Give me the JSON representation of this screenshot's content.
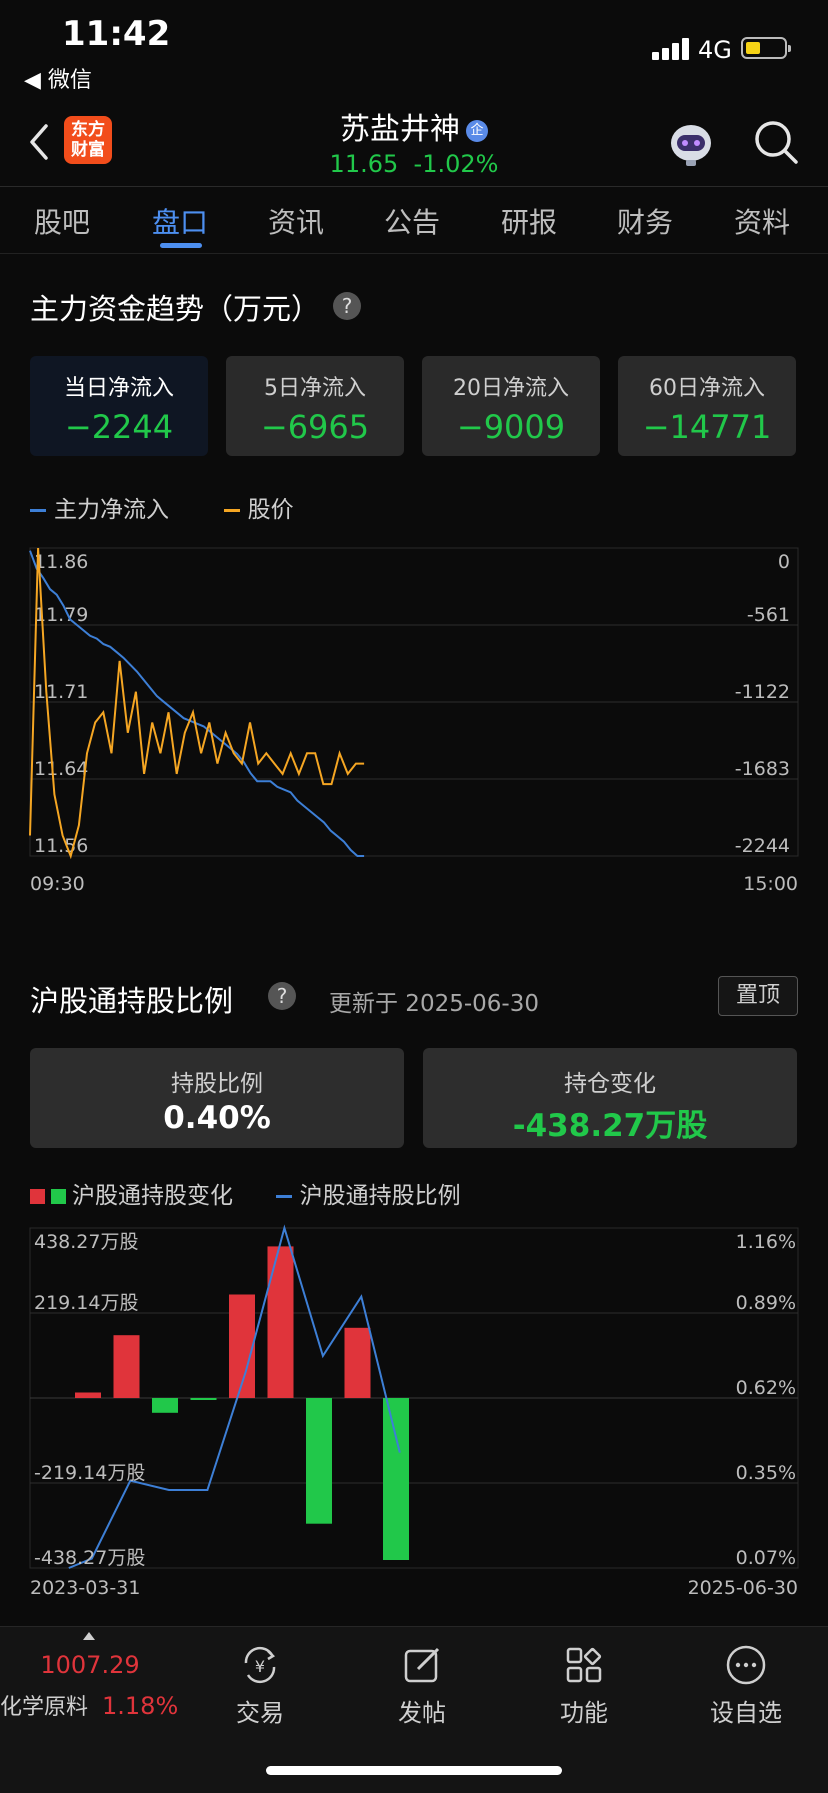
{
  "status": {
    "time": "11:42",
    "back_app": "◀ 微信",
    "network": "4G"
  },
  "header": {
    "logo_line1": "东方",
    "logo_line2": "财富",
    "stock_name": "苏盐井神",
    "badge": "企",
    "price": "11.65",
    "change": "-1.02%"
  },
  "tabs": [
    "股吧",
    "盘口",
    "资讯",
    "公告",
    "研报",
    "财务",
    "资料"
  ],
  "active_tab": "盘口",
  "flow": {
    "title": "主力资金趋势（万元）",
    "cards": [
      {
        "label": "当日净流入",
        "value": "−2244"
      },
      {
        "label": "5日净流入",
        "value": "−6965"
      },
      {
        "label": "20日净流入",
        "value": "−9009"
      },
      {
        "label": "60日净流入",
        "value": "−14771"
      }
    ],
    "legend_flow": "主力净流入",
    "legend_price": "股价",
    "left_ticks": [
      "11.86",
      "11.79",
      "11.71",
      "11.64",
      "11.56"
    ],
    "right_ticks": [
      "0",
      "-561",
      "-1122",
      "-1683",
      "-2244"
    ],
    "x_start": "09:30",
    "x_end": "15:00"
  },
  "hsgt": {
    "title": "沪股通持股比例",
    "updated": "更新于 2025-06-30",
    "pin": "置顶",
    "ratio_label": "持股比例",
    "ratio_value": "0.40%",
    "change_label": "持仓变化",
    "change_value": "-438.27万股",
    "legend_bar": "沪股通持股变化",
    "legend_line": "沪股通持股比例",
    "left_ticks": [
      "438.27万股",
      "219.14万股",
      "-219.14万股",
      "-438.27万股"
    ],
    "right_ticks": [
      "1.16%",
      "0.89%",
      "0.62%",
      "0.35%",
      "0.07%"
    ],
    "x_start": "2023-03-31",
    "x_end": "2025-06-30"
  },
  "colors": {
    "up": "#e0343b",
    "down": "#21c84a",
    "flow_line": "#3d7fd6",
    "price_line": "#f5a623",
    "accent": "#4d8ff0"
  },
  "chart_data": [
    {
      "type": "line",
      "title": "主力资金趋势（万元）",
      "x_range": [
        "09:30",
        "15:00"
      ],
      "ylim_left": [
        11.56,
        11.86
      ],
      "ylim_right": [
        -2244,
        0
      ],
      "series": [
        {
          "name": "主力净流入",
          "axis": "right",
          "values": [
            -20,
            -150,
            -220,
            -300,
            -340,
            -420,
            -520,
            -560,
            -600,
            -640,
            -660,
            -700,
            -720,
            -760,
            -800,
            -850,
            -900,
            -960,
            -1020,
            -1080,
            -1120,
            -1160,
            -1200,
            -1240,
            -1260,
            -1280,
            -1300,
            -1340,
            -1380,
            -1420,
            -1460,
            -1500,
            -1560,
            -1640,
            -1700,
            -1700,
            -1700,
            -1740,
            -1760,
            -1780,
            -1840,
            -1880,
            -1920,
            -1960,
            -2000,
            -2060,
            -2100,
            -2140,
            -2200,
            -2244,
            -2244
          ]
        },
        {
          "name": "股价",
          "axis": "left",
          "values": [
            11.58,
            11.86,
            11.72,
            11.62,
            11.58,
            11.56,
            11.59,
            11.66,
            11.69,
            11.7,
            11.66,
            11.75,
            11.68,
            11.72,
            11.64,
            11.69,
            11.66,
            11.7,
            11.64,
            11.68,
            11.7,
            11.66,
            11.69,
            11.65,
            11.68,
            11.66,
            11.65,
            11.69,
            11.65,
            11.66,
            11.65,
            11.64,
            11.66,
            11.64,
            11.66,
            11.66,
            11.63,
            11.63,
            11.66,
            11.64,
            11.65,
            11.65
          ]
        }
      ]
    },
    {
      "type": "bar",
      "title": "沪股通持股比例",
      "x_range": [
        "2023-03-31",
        "2025-06-30"
      ],
      "ylim_left": [
        -438.27,
        438.27
      ],
      "ylim_right": [
        0.07,
        1.16
      ],
      "series": [
        {
          "name": "沪股通持股变化",
          "unit": "万股",
          "values": [
            15,
            170,
            -40,
            -5,
            280,
            410,
            -340,
            190,
            -438.27
          ]
        },
        {
          "name": "沪股通持股比例",
          "unit": "%",
          "x_index": [
            0.4,
            1,
            2,
            3,
            4,
            5,
            6,
            7,
            8,
            9
          ],
          "values": [
            0.07,
            0.1,
            0.35,
            0.32,
            0.32,
            0.7,
            1.16,
            0.75,
            0.94,
            0.44
          ]
        }
      ]
    }
  ]
}
